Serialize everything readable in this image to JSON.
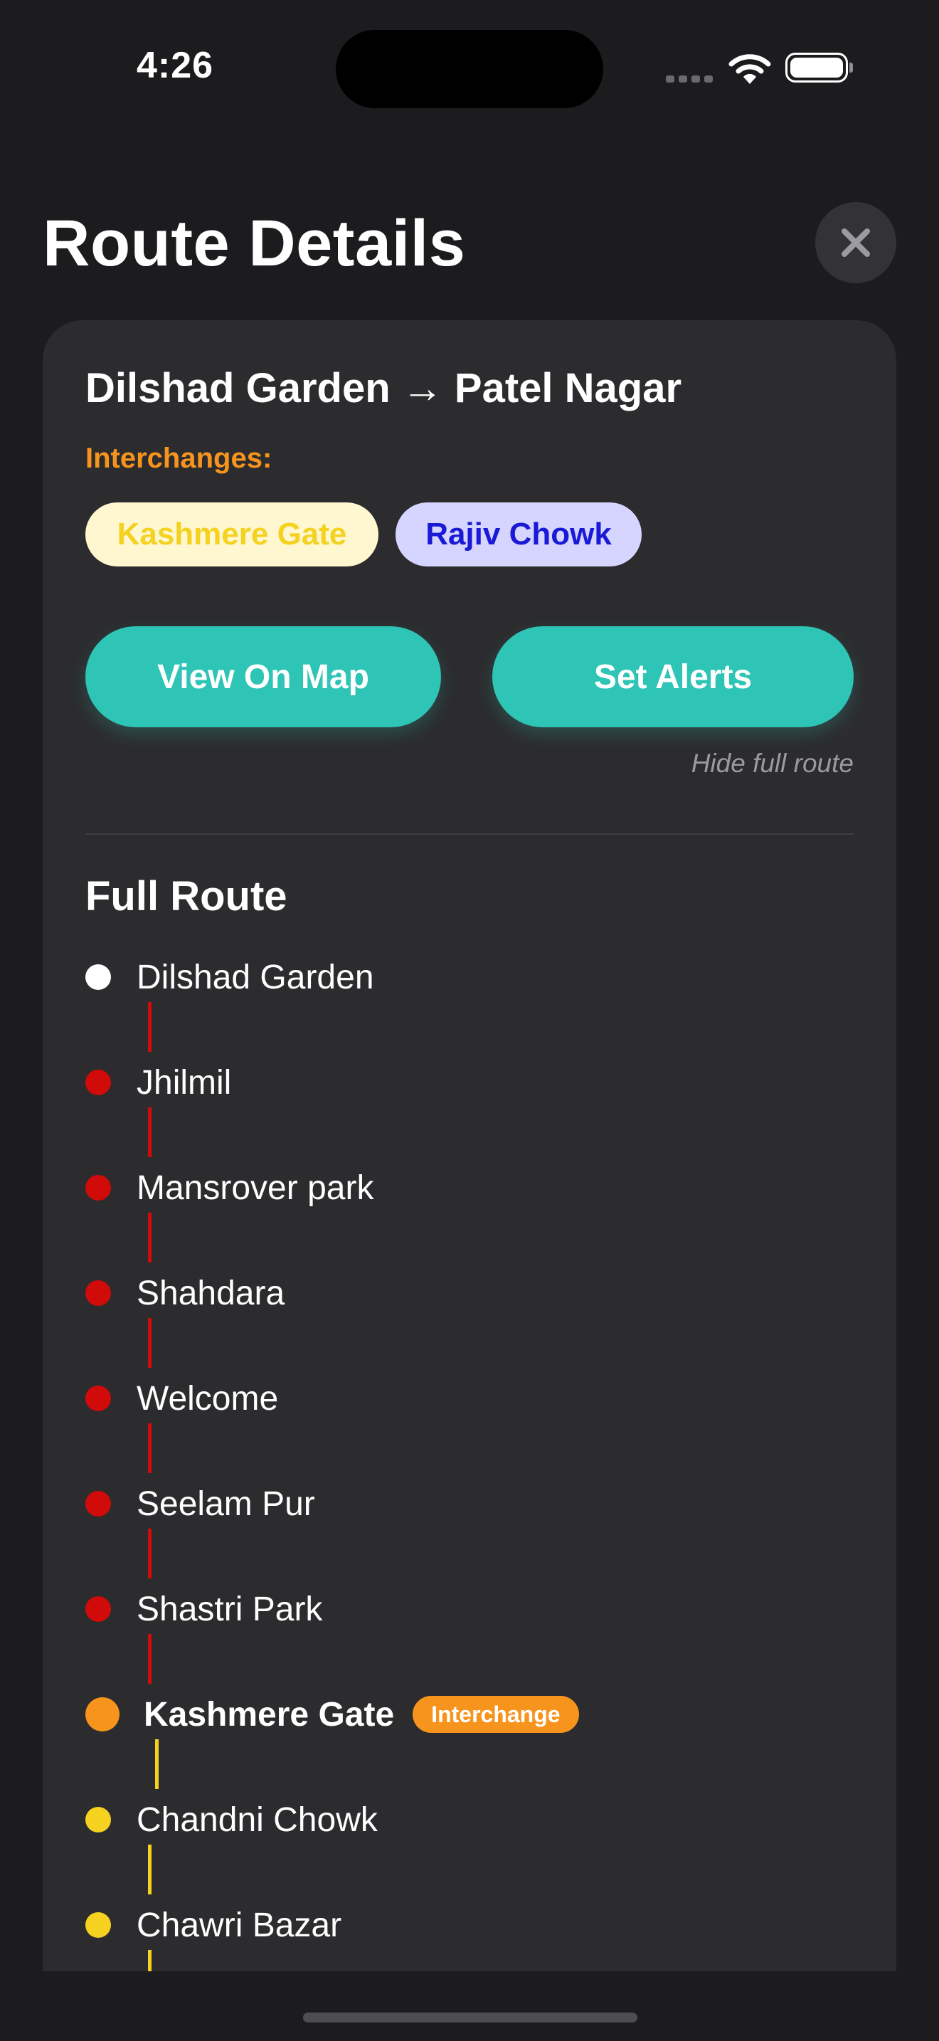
{
  "status_bar": {
    "time": "4:26"
  },
  "header": {
    "title": "Route Details",
    "close_icon": "close-icon"
  },
  "route": {
    "title": "Dilshad Garden → Patel Nagar",
    "interchanges_label": "Interchanges:",
    "interchanges": [
      {
        "label": "Kashmere Gate",
        "bg": "#fff7cf",
        "fg": "#f5d21f"
      },
      {
        "label": "Rajiv Chowk",
        "bg": "#d5d5ff",
        "fg": "#1a1ad6"
      }
    ],
    "view_map_label": "View On Map",
    "set_alerts_label": "Set Alerts",
    "hide_route_label": "Hide full route"
  },
  "full_route": {
    "title": "Full Route",
    "interchange_badge": "Interchange",
    "stations": [
      {
        "name": "Dilshad Garden",
        "color": "#ffffff"
      },
      {
        "name": "Jhilmil",
        "color": "#d10a0a"
      },
      {
        "name": "Mansrover park",
        "color": "#d10a0a"
      },
      {
        "name": "Shahdara",
        "color": "#d10a0a"
      },
      {
        "name": "Welcome",
        "color": "#d10a0a"
      },
      {
        "name": "Seelam Pur",
        "color": "#d10a0a"
      },
      {
        "name": "Shastri Park",
        "color": "#d10a0a"
      },
      {
        "name": "Kashmere Gate",
        "color": "#f7941d",
        "interchange": true
      },
      {
        "name": "Chandni Chowk",
        "color": "#f5d21f"
      },
      {
        "name": "Chawri Bazar",
        "color": "#f5d21f"
      }
    ]
  },
  "colors": {
    "accent": "#2ec4b6",
    "interchange": "#f7941d",
    "red_line": "#d10a0a",
    "yellow_line": "#f5d21f"
  }
}
